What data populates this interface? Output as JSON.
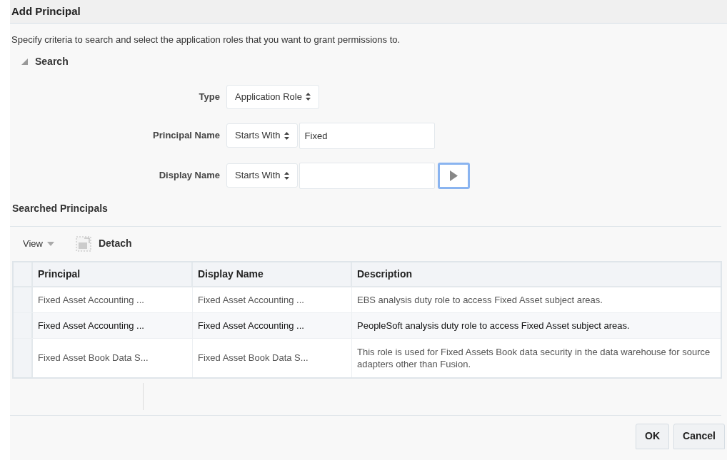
{
  "dialog": {
    "title": "Add Principal",
    "instructions": "Specify criteria to search and select the application roles that you want to grant permissions to."
  },
  "search": {
    "label": "Search",
    "expanded": true,
    "fields": [
      {
        "label": "Type",
        "kind": "select",
        "operator": "Application Role"
      },
      {
        "label": "Principal Name",
        "kind": "text",
        "operator": "Starts With",
        "value": "Fixed"
      },
      {
        "label": "Display Name",
        "kind": "text",
        "operator": "Starts With",
        "go": true
      }
    ]
  },
  "results": {
    "title": "Searched Principals",
    "toolbar": {
      "view": "View",
      "detach": "Detach"
    },
    "columns": [
      "Principal",
      "Display Name",
      "Description"
    ],
    "rows": [
      {
        "selected": false,
        "cells": [
          "Fixed Asset Accounting ...",
          "Fixed Asset Accounting ...",
          "EBS analysis duty role to access Fixed Asset subject areas."
        ]
      },
      {
        "selected": true,
        "cells": [
          "Fixed Asset Accounting ...",
          "Fixed Asset Accounting ...",
          "PeopleSoft analysis duty role to access Fixed Asset subject areas."
        ]
      },
      {
        "selected": false,
        "cells": [
          "Fixed Asset Book Data S...",
          "Fixed Asset Book Data S...",
          "This role is used for Fixed Assets Book data security in the data warehouse for source adapters other than Fusion."
        ]
      }
    ]
  },
  "buttons": [
    "OK",
    "Cancel"
  ]
}
